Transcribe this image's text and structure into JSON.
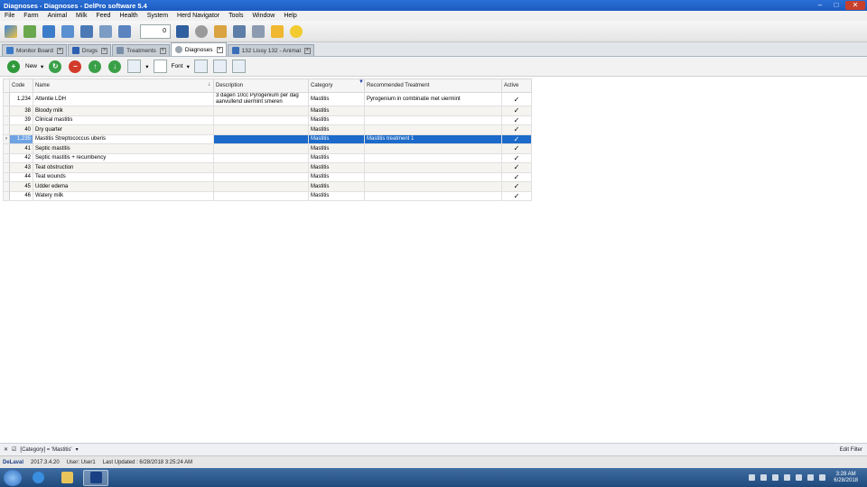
{
  "window": {
    "title": "Diagnoses - Diagnoses - DelPro software 5.4",
    "min": "–",
    "max": "□",
    "close": "✕"
  },
  "menu": [
    "File",
    "Farm",
    "Animal",
    "Milk",
    "Feed",
    "Health",
    "System",
    "Herd Navigator",
    "Tools",
    "Window",
    "Help"
  ],
  "toolbar": {
    "counter_value": "0"
  },
  "tabs": [
    {
      "label": "Monitor Board"
    },
    {
      "label": "Drugs"
    },
    {
      "label": "Treatments"
    },
    {
      "label": "Diagnoses"
    },
    {
      "label": "132 Lissy 132 - Animal"
    }
  ],
  "actions": {
    "new_label": "New",
    "font_label": "Font"
  },
  "grid": {
    "columns": {
      "code": "Code",
      "name": "Name",
      "description": "Description",
      "category": "Category",
      "recommended": "Recommended Treatment",
      "active": "Active"
    },
    "rows": [
      {
        "code": "1,234",
        "name": "Attentie LDH",
        "description": "3 dagen 10cc Pyrogenium per dag aanvullend uiermint smeren",
        "category": "Mastitis",
        "recommended": "Pyrogenium in combinatie met uiermint",
        "active": "✓"
      },
      {
        "code": "38",
        "name": "Bloody milk",
        "description": "",
        "category": "Mastitis",
        "recommended": "",
        "active": "✓"
      },
      {
        "code": "39",
        "name": "Clinical mastitis",
        "description": "",
        "category": "Mastitis",
        "recommended": "",
        "active": "✓"
      },
      {
        "code": "40",
        "name": "Dry quarter",
        "description": "",
        "category": "Mastitis",
        "recommended": "",
        "active": "✓"
      },
      {
        "code": "1,235",
        "name": "Mastitis Streptococcus uberis",
        "description": "",
        "category": "Mastitis",
        "recommended": "Mastitis treatment 1",
        "active": "✓"
      },
      {
        "code": "41",
        "name": "Septic mastitis",
        "description": "",
        "category": "Mastitis",
        "recommended": "",
        "active": "✓"
      },
      {
        "code": "42",
        "name": "Septic mastitis + recumbency",
        "description": "",
        "category": "Mastitis",
        "recommended": "",
        "active": "✓"
      },
      {
        "code": "43",
        "name": "Teat obstruction",
        "description": "",
        "category": "Mastitis",
        "recommended": "",
        "active": "✓"
      },
      {
        "code": "44",
        "name": "Teat wounds",
        "description": "",
        "category": "Mastitis",
        "recommended": "",
        "active": "✓"
      },
      {
        "code": "45",
        "name": "Udder edema",
        "description": "",
        "category": "Mastitis",
        "recommended": "",
        "active": "✓"
      },
      {
        "code": "46",
        "name": "Watery milk",
        "description": "",
        "category": "Mastitis",
        "recommended": "",
        "active": "✓"
      }
    ]
  },
  "filter": {
    "expression": "[Category] = 'Mastitis'",
    "edit_label": "Edit Filter"
  },
  "status": {
    "brand": "DeLaval",
    "version": "2017.3.4.20",
    "user": "User: User1",
    "updated": "Last Updated : 6/28/2018 3:25:24 AM"
  },
  "clock": {
    "time": "3:28 AM",
    "date": "6/28/2018"
  }
}
